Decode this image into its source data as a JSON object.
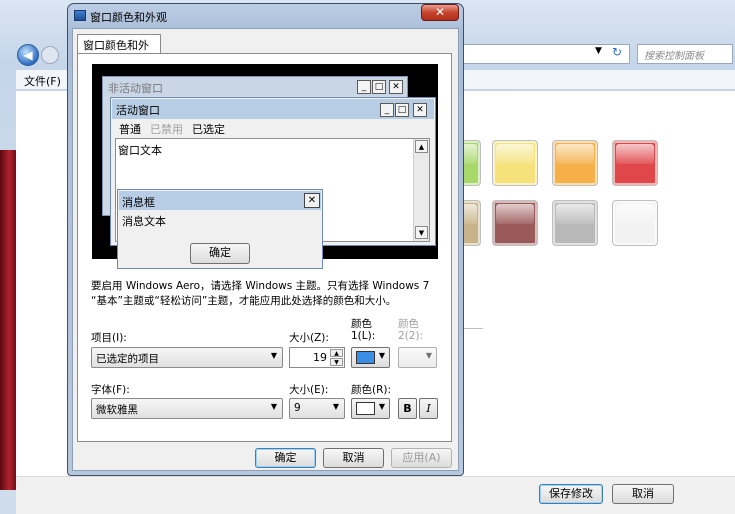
{
  "background_window": {
    "search_placeholder": "搜索控制面板",
    "menu": {
      "file": "文件(F)"
    },
    "buttons": {
      "save": "保存修改",
      "cancel": "取消"
    },
    "swatches": [
      {
        "color": "#a8d86a"
      },
      {
        "color": "#f5e27a"
      },
      {
        "color": "#f5b04a"
      },
      {
        "color": "#e0474a"
      },
      {
        "color": "#c9b489"
      },
      {
        "color": "#9b5a5a"
      },
      {
        "color": "#b9b9b9"
      },
      {
        "color": "#f2f2f2"
      }
    ]
  },
  "dialog": {
    "title": "窗口颜色和外观",
    "close_glyph": "✕",
    "tab": "窗口颜色和外观",
    "preview": {
      "inactive_title": "非活动窗口",
      "active_title": "活动窗口",
      "menu_items": {
        "normal": "普通",
        "disabled": "已禁用",
        "selected": "已选定"
      },
      "window_text": "窗口文本",
      "msgbox_title": "消息框",
      "msgbox_text": "消息文本",
      "ok": "确定"
    },
    "note": "要启用 Windows Aero，请选择 Windows 主题。只有选择 Windows 7 “基本”主题或“轻松访问”主题，才能应用此处选择的颜色和大小。",
    "labels": {
      "item": "项目(I):",
      "size_z": "大小(Z):",
      "color1_line1": "颜色",
      "color1_line2": "1(L):",
      "color2_line1": "颜色",
      "color2_line2": "2(2):",
      "font": "字体(F):",
      "size_e": "大小(E):",
      "color_r": "颜色(R):"
    },
    "item_value": "已选定的项目",
    "size_value": "19",
    "font_value": "微软雅黑",
    "font_size_value": "9",
    "bold": "B",
    "italic": "I",
    "color1": "#3a8ee6",
    "font_color": "#ffffff",
    "buttons": {
      "ok": "确定",
      "cancel": "取消",
      "apply": "应用(A)"
    }
  }
}
